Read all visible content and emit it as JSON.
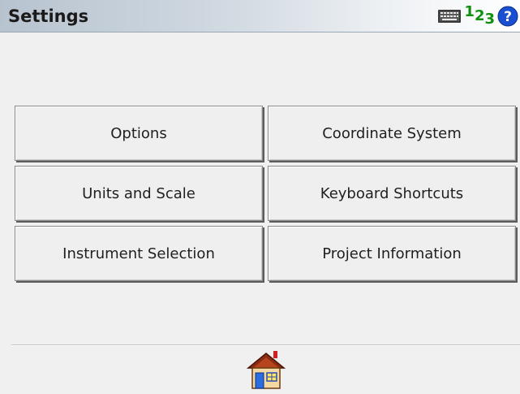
{
  "window": {
    "title": "Settings",
    "icons": [
      "keyboard-icon",
      "numeric-input-icon",
      "help-icon"
    ],
    "numeric_icon_text": [
      "1",
      "2",
      "3"
    ]
  },
  "buttons": {
    "options": "Options",
    "coordinate_system": "Coordinate System",
    "units_and_scale": "Units and Scale",
    "keyboard_shortcuts": "Keyboard Shortcuts",
    "instrument_selection": "Instrument Selection",
    "project_information": "Project Information"
  },
  "bottom": {
    "home_icon": "home-icon"
  },
  "colors": {
    "titlebar_start": "#b7c3cf",
    "titlebar_end": "#ffffff",
    "background": "#f0f0f0",
    "numeric_icon": "#109010",
    "help_icon": "#1a4fd1",
    "home_roof": "#8b2c12",
    "home_wall": "#f4d9a4",
    "home_door": "#2a6de0"
  }
}
